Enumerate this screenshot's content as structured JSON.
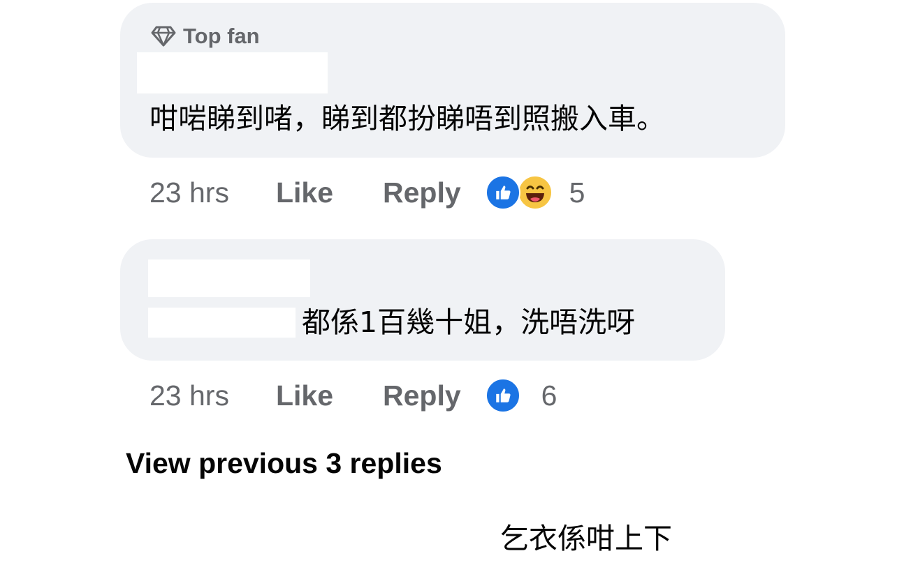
{
  "comments": [
    {
      "badge": "Top fan",
      "text": "咁啱睇到啫，睇到都扮睇唔到照搬入車。",
      "time": "23 hrs",
      "like_label": "Like",
      "reply_label": "Reply",
      "reactions": [
        "like-icon",
        "haha-icon"
      ],
      "reaction_count": "5"
    },
    {
      "text": "都係1百幾十姐，洗唔洗呀",
      "time": "23 hrs",
      "like_label": "Like",
      "reply_label": "Reply",
      "reactions": [
        "like-icon"
      ],
      "reaction_count": "6"
    }
  ],
  "view_previous_replies": "View previous 3 replies",
  "partial_comment": {
    "text": "乞衣係咁上下"
  },
  "colors": {
    "bubble_bg": "#f0f2f5",
    "meta_text": "#65676b",
    "body_text": "#050505",
    "like_blue": "#1b74e4",
    "haha_yellow": "#f7c543"
  }
}
